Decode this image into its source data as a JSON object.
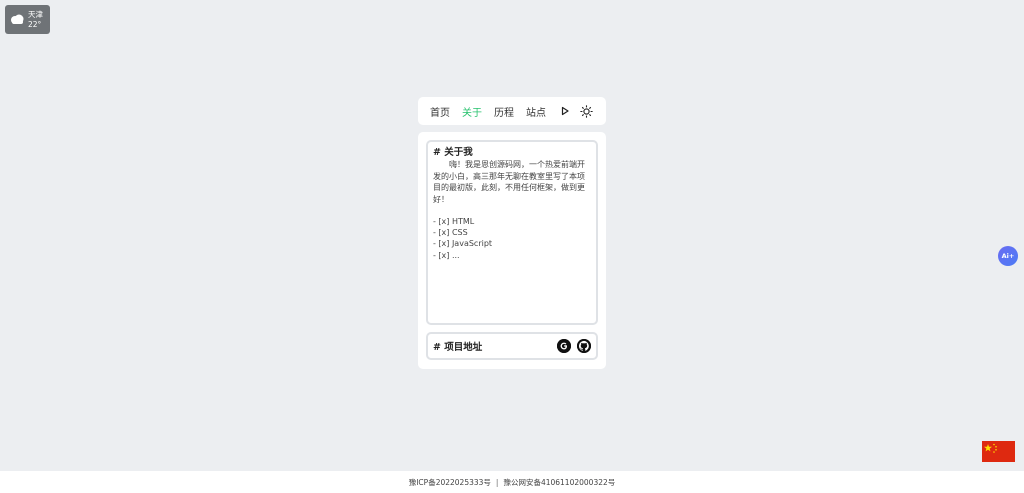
{
  "weather": {
    "city": "天津",
    "temp": "22°",
    "icon": "cloudy-icon"
  },
  "nav": {
    "items": [
      {
        "label": "首页",
        "active": false
      },
      {
        "label": "关于",
        "active": true
      },
      {
        "label": "历程",
        "active": false
      },
      {
        "label": "站点",
        "active": false
      }
    ],
    "play_icon": "play-icon",
    "theme_icon": "sun-icon",
    "active_color": "#27c26e"
  },
  "about": {
    "title": "# 关于我",
    "text": "嗨！我是恩创源码网，一个热爱前端开发的小白，高三那年无聊在教室里写了本项目的最初版，此刻，不用任何框架，做到更好！",
    "skills": [
      "- [x] HTML",
      "- [x] CSS",
      "- [x] JavaScript",
      "- [x] ..."
    ]
  },
  "project": {
    "title": "# 项目地址",
    "icons": [
      "gitee-icon",
      "github-icon"
    ]
  },
  "ai_button": {
    "label": "Ai+"
  },
  "flag": {
    "icon": "china-flag-icon",
    "color": "#de2910"
  },
  "footer": {
    "icp": "豫ICP备2022025333号",
    "separator": "|",
    "police": "豫公网安备41061102000322号"
  }
}
